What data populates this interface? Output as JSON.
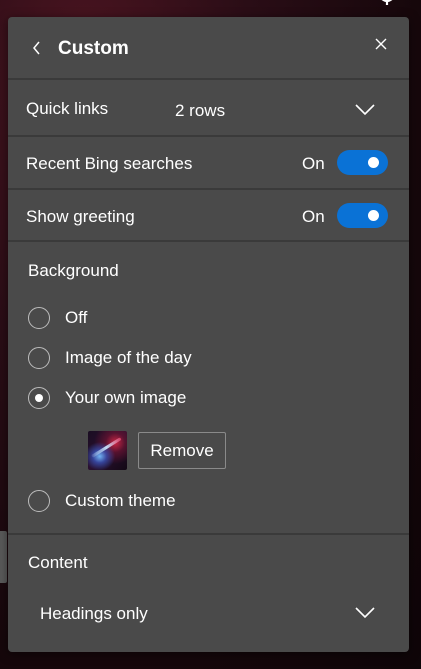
{
  "theme": {
    "accent": "#0a72d6",
    "panel_bg": "#4a4a4a",
    "divider": "#3a3a3a"
  },
  "icons": {
    "back": "chevron-left-icon",
    "close": "close-icon",
    "dropdown": "chevron-down-icon",
    "settings": "gear-icon"
  },
  "header": {
    "title": "Custom"
  },
  "quick_links": {
    "label": "Quick links",
    "value": "2 rows"
  },
  "recent_searches": {
    "label": "Recent Bing searches",
    "status": "On",
    "enabled": true
  },
  "greeting": {
    "label": "Show greeting",
    "status": "On",
    "enabled": true
  },
  "background": {
    "label": "Background",
    "options": [
      {
        "label": "Off",
        "selected": false
      },
      {
        "label": "Image of the day",
        "selected": false
      },
      {
        "label": "Your own image",
        "selected": true
      },
      {
        "label": "Custom theme",
        "selected": false
      }
    ],
    "remove_label": "Remove"
  },
  "content": {
    "label": "Content",
    "value": "Headings only"
  }
}
